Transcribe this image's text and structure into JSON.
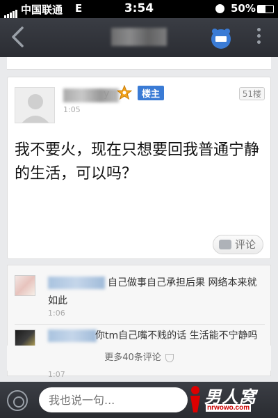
{
  "status_bar": {
    "carrier": "中国联通",
    "network": "E",
    "time": "3:54",
    "battery": "50%"
  },
  "post": {
    "username_suffix": "y",
    "owner_badge": "楼主",
    "floor": "51楼",
    "time": "1:05",
    "text": "我不要火，现在只想要回我普通宁静的生活，可以吗？",
    "comment_button": "评论"
  },
  "comments": [
    {
      "text": "自己做事自己承担后果 网络本来就如此",
      "time": "1:06"
    },
    {
      "text": "你tm自己嘴不贱的话 生活能不宁静吗",
      "time": "1:07"
    }
  ],
  "more_comments": "更多40条评论",
  "bottom_bar": {
    "input_placeholder": "我也说一句...",
    "logo_text": "男人窝",
    "logo_url": "nrwowo.com"
  }
}
